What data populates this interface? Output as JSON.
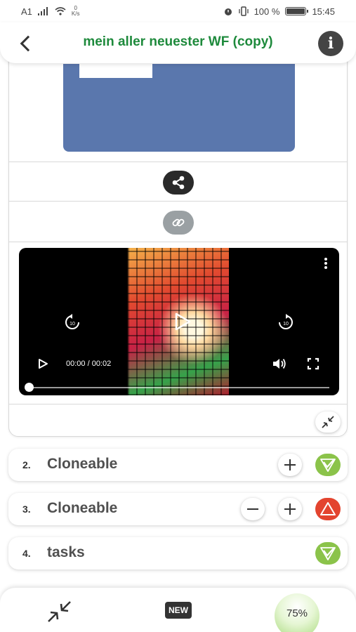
{
  "status_bar": {
    "carrier": "A1",
    "speed_value": "0",
    "speed_unit": "K/s",
    "battery": "100 %",
    "time": "15:45"
  },
  "header": {
    "title": "mein aller neuester WF (copy)",
    "info_label": "i"
  },
  "video": {
    "time_display": "00:00 / 00:02",
    "progress_fraction": 0.0
  },
  "tasks": [
    {
      "number": "2.",
      "name": "Cloneable",
      "status": "ok"
    },
    {
      "number": "3.",
      "name": "Cloneable",
      "status": "warning"
    },
    {
      "number": "4.",
      "name": "tasks",
      "status": "ok"
    }
  ],
  "bottom_bar": {
    "new_label": "NEW",
    "progress_label": "75%"
  },
  "colors": {
    "title_green": "#1e8a3c",
    "image_blue": "#5a77ad",
    "status_ok": "#8bc34a",
    "status_warning": "#e3442f"
  },
  "icons": [
    "back-icon",
    "info-icon",
    "share-icon",
    "link-icon",
    "more-vert-icon",
    "replay-10-icon",
    "forward-10-icon",
    "play-icon",
    "volume-icon",
    "fullscreen-icon",
    "collapse-icon",
    "plus-icon",
    "minus-icon",
    "check-icon",
    "warning-icon"
  ]
}
